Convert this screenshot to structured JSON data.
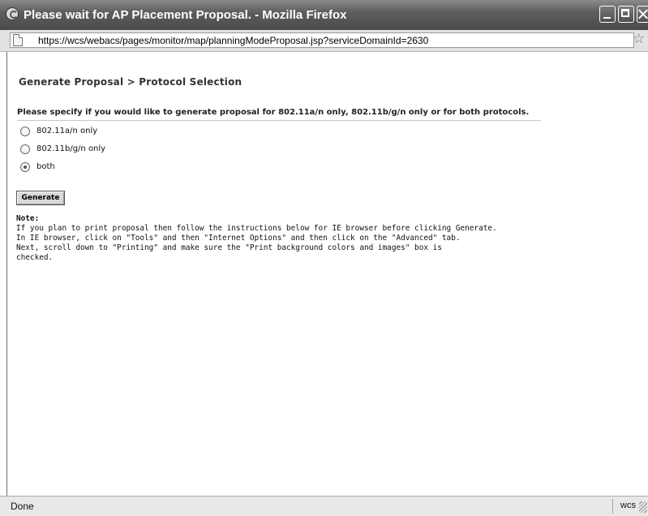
{
  "window": {
    "title": "Please wait for AP Placement Proposal. - Mozilla Firefox"
  },
  "address_bar": {
    "url": "https://wcs/webacs/pages/monitor/map/planningModeProposal.jsp?serviceDomainId=2630"
  },
  "page": {
    "heading": "Generate Proposal > Protocol Selection",
    "prompt": "Please specify if you would like to generate proposal for 802.11a/n only, 802.11b/g/n only or for both protocols.",
    "options": [
      {
        "label": "802.11a/n only",
        "checked": false
      },
      {
        "label": "802.11b/g/n only",
        "checked": false
      },
      {
        "label": "both",
        "checked": true
      }
    ],
    "generate_label": "Generate",
    "note_title": "Note:",
    "note_lines": [
      "If you plan to print proposal then follow the instructions below for IE browser before clicking Generate.",
      "In IE browser, click on \"Tools\" and then \"Internet Options\" and then click on the \"Advanced\" tab.",
      "Next, scroll down to \"Printing\" and make sure the \"Print background colors and images\" box is",
      "checked."
    ]
  },
  "status_bar": {
    "status": "Done",
    "zone": "wcs"
  }
}
